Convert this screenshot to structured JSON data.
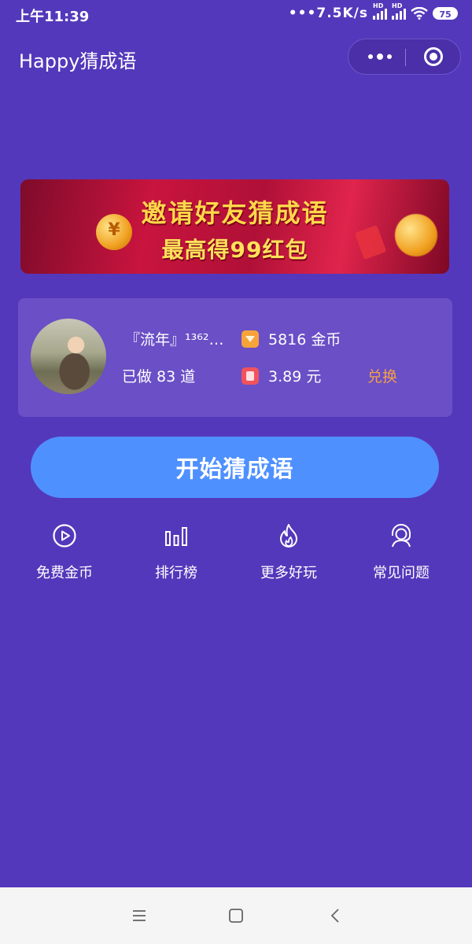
{
  "status_bar": {
    "time": "上午11:39",
    "network_speed": "•••7.5K/s",
    "hd1": "HD",
    "hd2": "HD",
    "battery": "75"
  },
  "header": {
    "title": "Happy猜成语",
    "more_icon": "more-dots-icon",
    "close_icon": "target-close-icon"
  },
  "banner": {
    "line1": "邀请好友猜成语",
    "line2": "最高得99红包",
    "coin_symbol": "¥"
  },
  "user": {
    "name": "『流年』¹³⁶²…",
    "done": "已做 83 道",
    "coins": "5816 金币",
    "money": "3.89 元",
    "exchange_label": "兑换"
  },
  "start_button": "开始猜成语",
  "shortcuts": [
    {
      "label": "免费金币",
      "icon": "play-circle-icon"
    },
    {
      "label": "排行榜",
      "icon": "bar-chart-icon"
    },
    {
      "label": "更多好玩",
      "icon": "flame-icon"
    },
    {
      "label": "常见问题",
      "icon": "headset-icon"
    }
  ],
  "navbar": {
    "menu_icon": "menu-icon",
    "home_icon": "home-square-icon",
    "back_icon": "back-chevron-icon"
  },
  "colors": {
    "background": "#5438bb",
    "card": "#6a4fc6",
    "start_button": "#4f90ff",
    "exchange": "#f4a04a"
  }
}
